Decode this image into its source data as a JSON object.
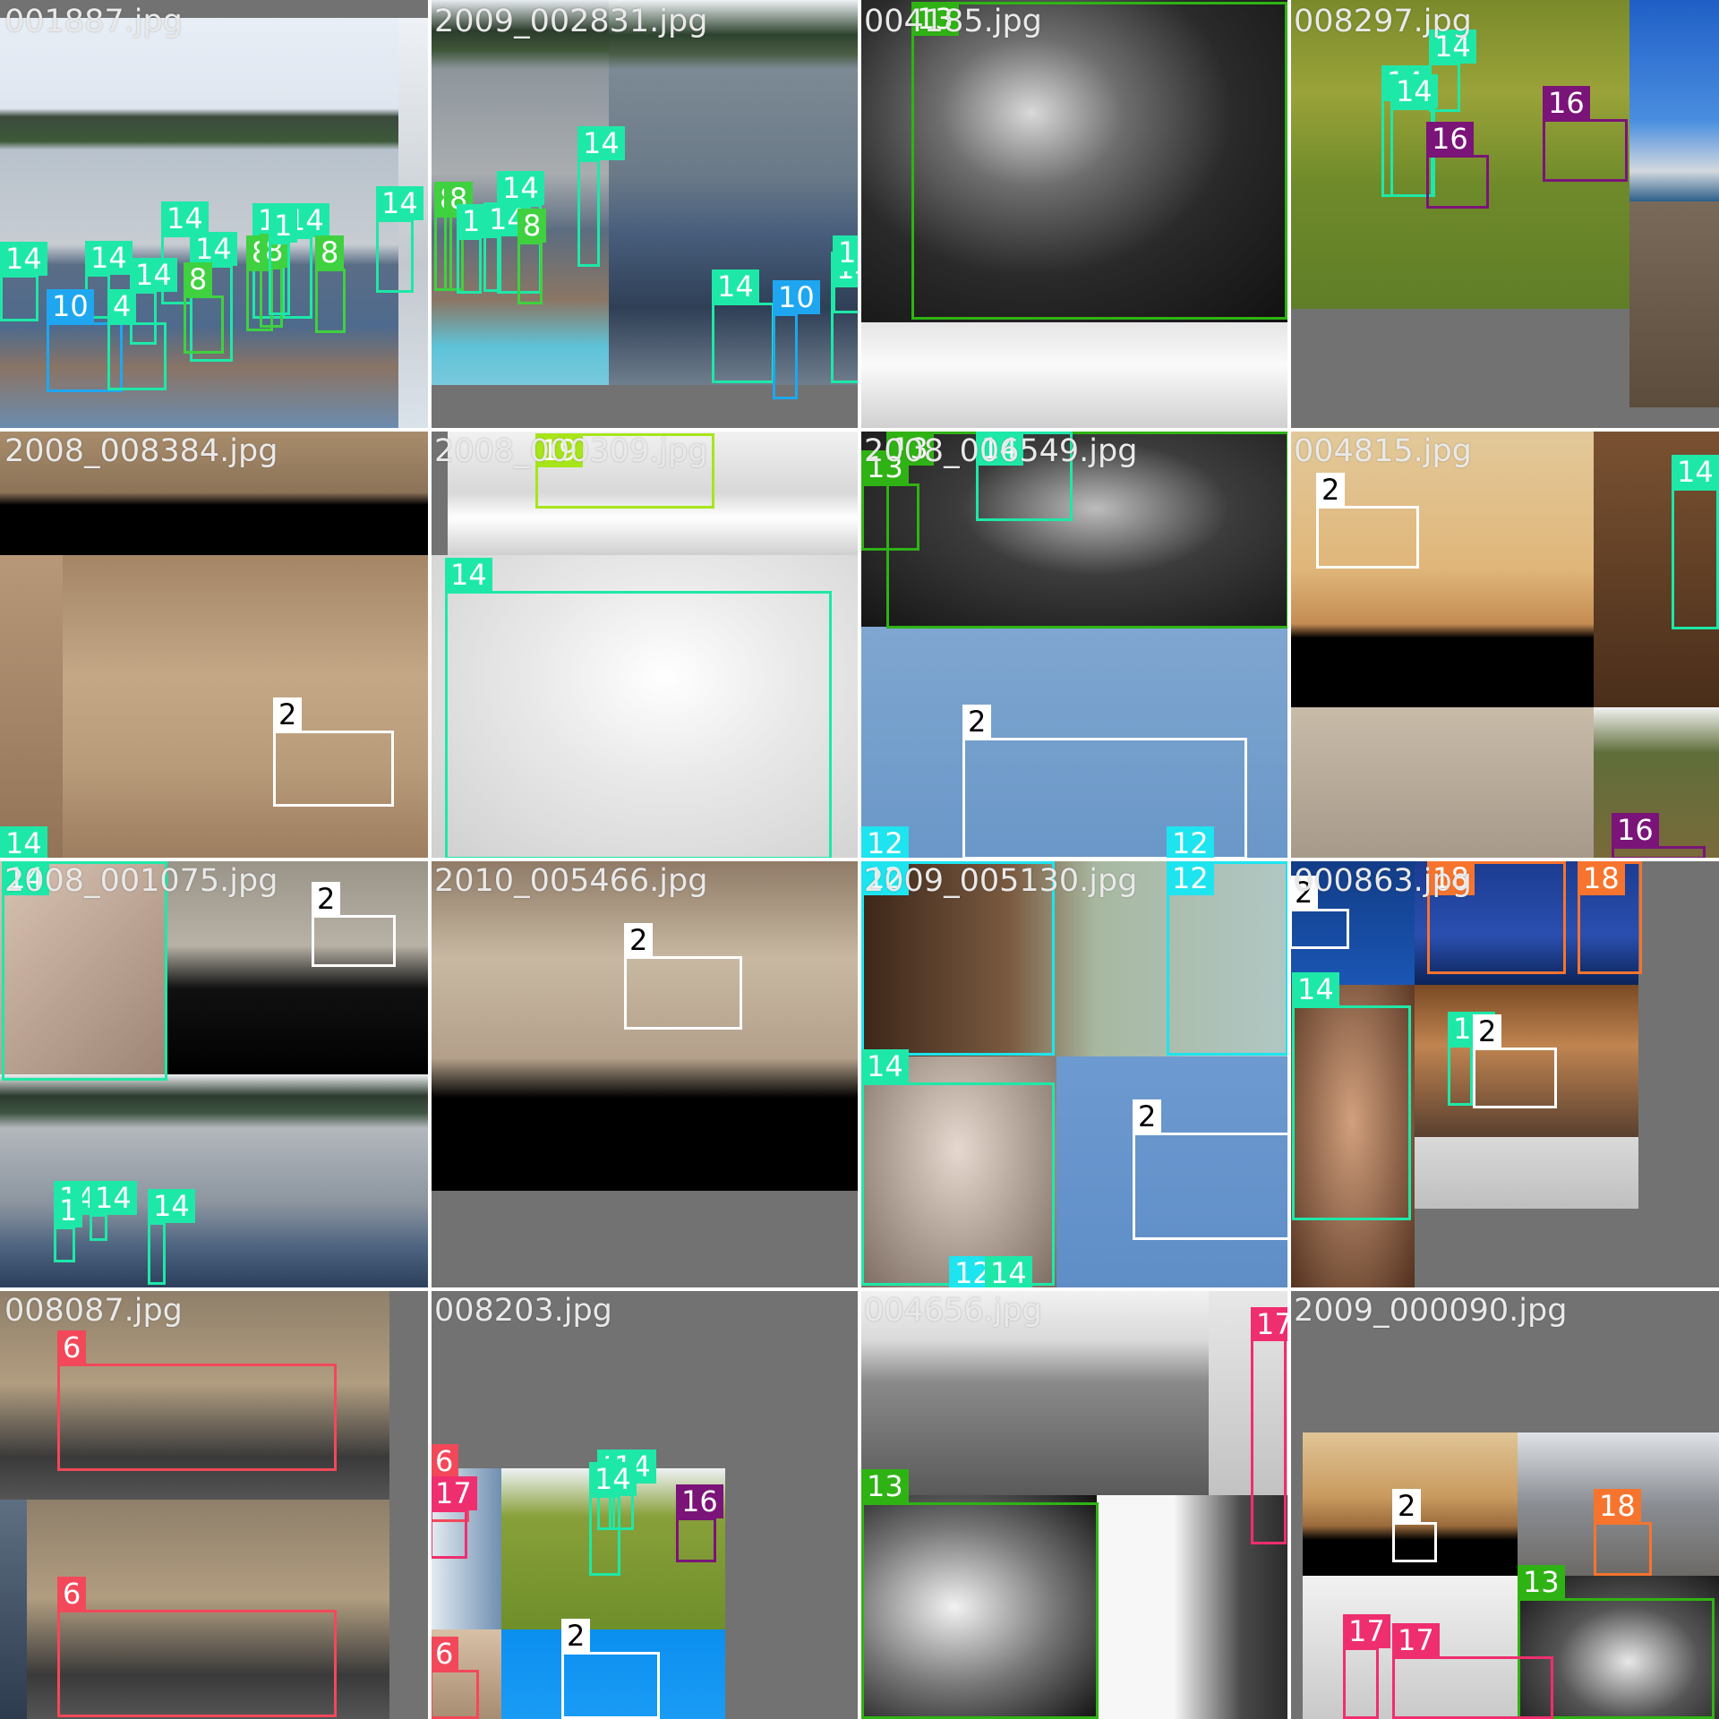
{
  "class_colors": {
    "2": "#ffffff",
    "6": "#f2485a",
    "8": "#3fd13f",
    "10": "#1ea7f0",
    "12": "#1ee4ef",
    "13": "#2fb314",
    "14": "#1ee8a8",
    "16": "#7a1478",
    "17": "#ef2e6f",
    "18": "#f6742e",
    "19": "#a7e51a"
  },
  "tiles": [
    {
      "name": "001887.jpg",
      "boxes": [
        {
          "cls": "14"
        },
        {
          "cls": "14"
        },
        {
          "cls": "14"
        },
        {
          "cls": "14"
        },
        {
          "cls": "14"
        },
        {
          "cls": "14"
        },
        {
          "cls": "14"
        },
        {
          "cls": "10"
        },
        {
          "cls": "8"
        },
        {
          "cls": "8"
        },
        {
          "cls": "8"
        },
        {
          "cls": "1"
        },
        {
          "cls": "4"
        },
        {
          "cls": "14"
        },
        {
          "cls": "8"
        }
      ]
    },
    {
      "name": "2009_002831.jpg",
      "boxes": [
        {
          "cls": "14"
        },
        {
          "cls": "14"
        },
        {
          "cls": "14"
        },
        {
          "cls": "14"
        },
        {
          "cls": "10"
        },
        {
          "cls": "14"
        },
        {
          "cls": "8"
        },
        {
          "cls": "8"
        },
        {
          "cls": "1"
        },
        {
          "cls": "14"
        },
        {
          "cls": "8"
        }
      ]
    },
    {
      "name": "004185.jpg",
      "boxes": [
        {
          "cls": "13"
        }
      ]
    },
    {
      "name": "008297.jpg",
      "boxes": [
        {
          "cls": "14"
        },
        {
          "cls": "14"
        },
        {
          "cls": "14"
        },
        {
          "cls": "16"
        },
        {
          "cls": "16"
        }
      ]
    },
    {
      "name": "2008_008384.jpg",
      "boxes": [
        {
          "cls": "2"
        },
        {
          "cls": "14"
        }
      ]
    },
    {
      "name": "2008_000309.jpg",
      "boxes": [
        {
          "cls": "19"
        },
        {
          "cls": "14"
        }
      ]
    },
    {
      "name": "2008_006549.jpg",
      "boxes": [
        {
          "cls": "13"
        },
        {
          "cls": "14"
        },
        {
          "cls": "13"
        },
        {
          "cls": "2"
        },
        {
          "cls": "12"
        },
        {
          "cls": "12"
        }
      ]
    },
    {
      "name": "004815.jpg",
      "boxes": [
        {
          "cls": "2"
        },
        {
          "cls": "14"
        },
        {
          "cls": "16"
        }
      ]
    },
    {
      "name": "2008_001075.jpg",
      "boxes": [
        {
          "cls": "14"
        },
        {
          "cls": "2"
        },
        {
          "cls": "14"
        },
        {
          "cls": "14"
        },
        {
          "cls": "1"
        },
        {
          "cls": "14"
        }
      ]
    },
    {
      "name": "2010_005466.jpg",
      "boxes": [
        {
          "cls": "2"
        }
      ]
    },
    {
      "name": "2009_005130.jpg",
      "boxes": [
        {
          "cls": "12"
        },
        {
          "cls": "12"
        },
        {
          "cls": "14"
        },
        {
          "cls": "2"
        },
        {
          "cls": "12"
        },
        {
          "cls": "14"
        }
      ]
    },
    {
      "name": "000863.jpg",
      "boxes": [
        {
          "cls": "2"
        },
        {
          "cls": "18"
        },
        {
          "cls": "18"
        },
        {
          "cls": "14"
        },
        {
          "cls": "14"
        },
        {
          "cls": "2"
        }
      ]
    },
    {
      "name": "008087.jpg",
      "boxes": [
        {
          "cls": "6"
        },
        {
          "cls": "6"
        }
      ]
    },
    {
      "name": "008203.jpg",
      "boxes": [
        {
          "cls": "14"
        },
        {
          "cls": "14"
        },
        {
          "cls": "14"
        },
        {
          "cls": "6"
        },
        {
          "cls": "16"
        },
        {
          "cls": "17"
        },
        {
          "cls": "2"
        },
        {
          "cls": "6"
        }
      ]
    },
    {
      "name": "004656.jpg",
      "boxes": [
        {
          "cls": "17"
        },
        {
          "cls": "13"
        }
      ]
    },
    {
      "name": "2009_000090.jpg",
      "boxes": [
        {
          "cls": "2"
        },
        {
          "cls": "18"
        },
        {
          "cls": "13"
        },
        {
          "cls": "17"
        },
        {
          "cls": "17"
        }
      ]
    }
  ]
}
